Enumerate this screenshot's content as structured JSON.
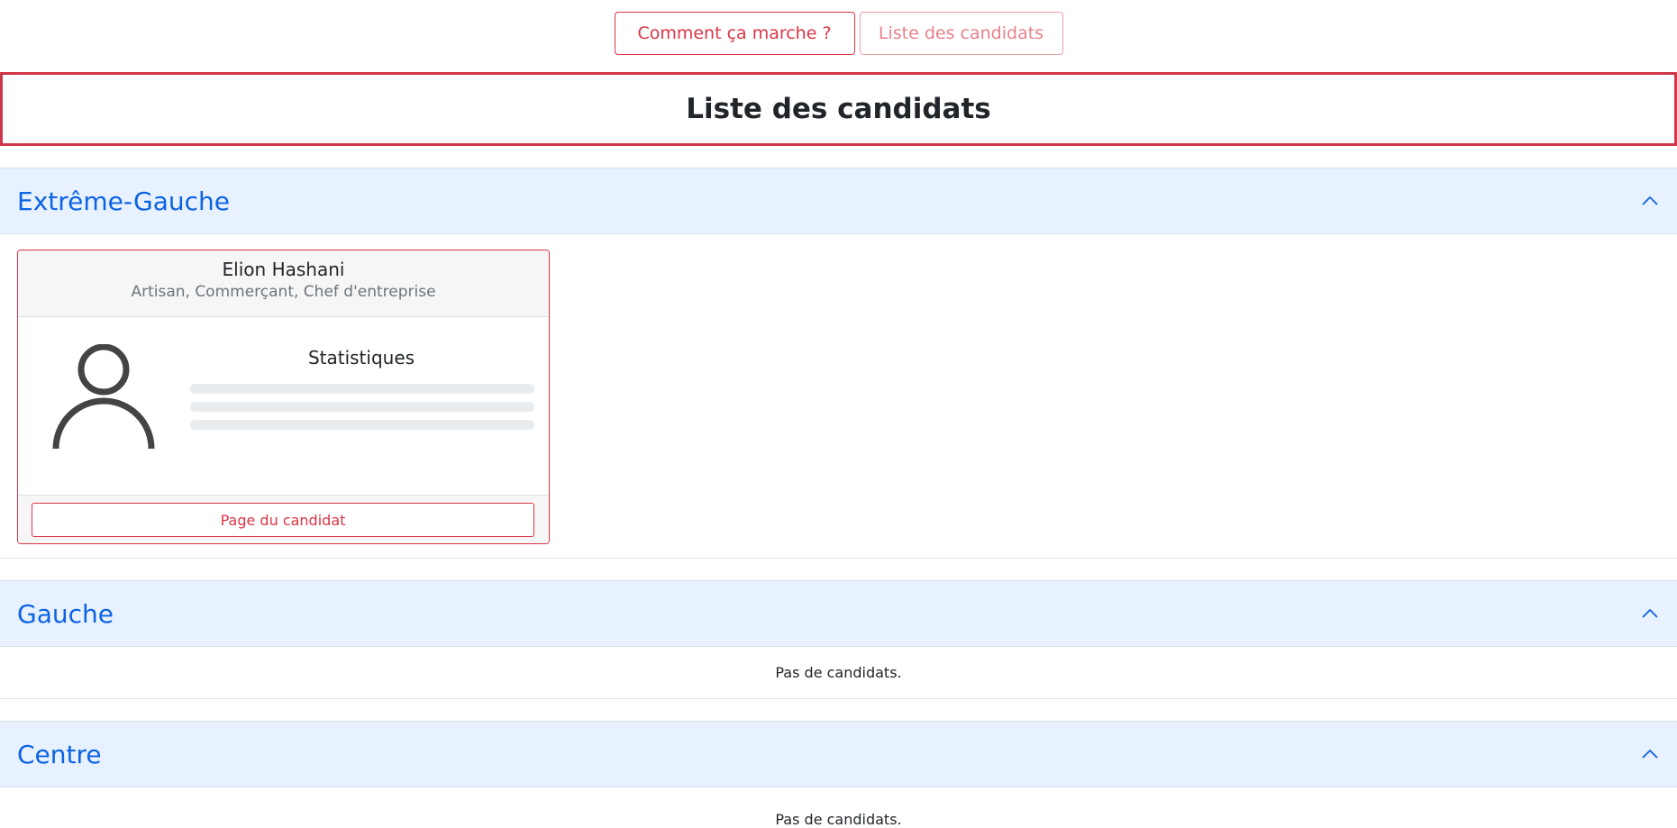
{
  "nav": {
    "how_it_works": "Comment ça marche ?",
    "candidates_list": "Liste des candidats"
  },
  "page_title": "Liste des candidats",
  "sections": [
    {
      "title": "Extrême-Gauche",
      "candidates": [
        {
          "name": "Elion Hashani",
          "role": "Artisan, Commerçant, Chef d'entreprise",
          "stats_title": "Statistiques",
          "button": "Page du candidat"
        }
      ]
    },
    {
      "title": "Gauche",
      "empty_text": "Pas de candidats."
    },
    {
      "title": "Centre",
      "empty_text": "Pas de candidats."
    }
  ],
  "colors": {
    "accent": "#dc3545",
    "section_bg": "#e7f1ff",
    "section_title": "#0c63e4"
  }
}
